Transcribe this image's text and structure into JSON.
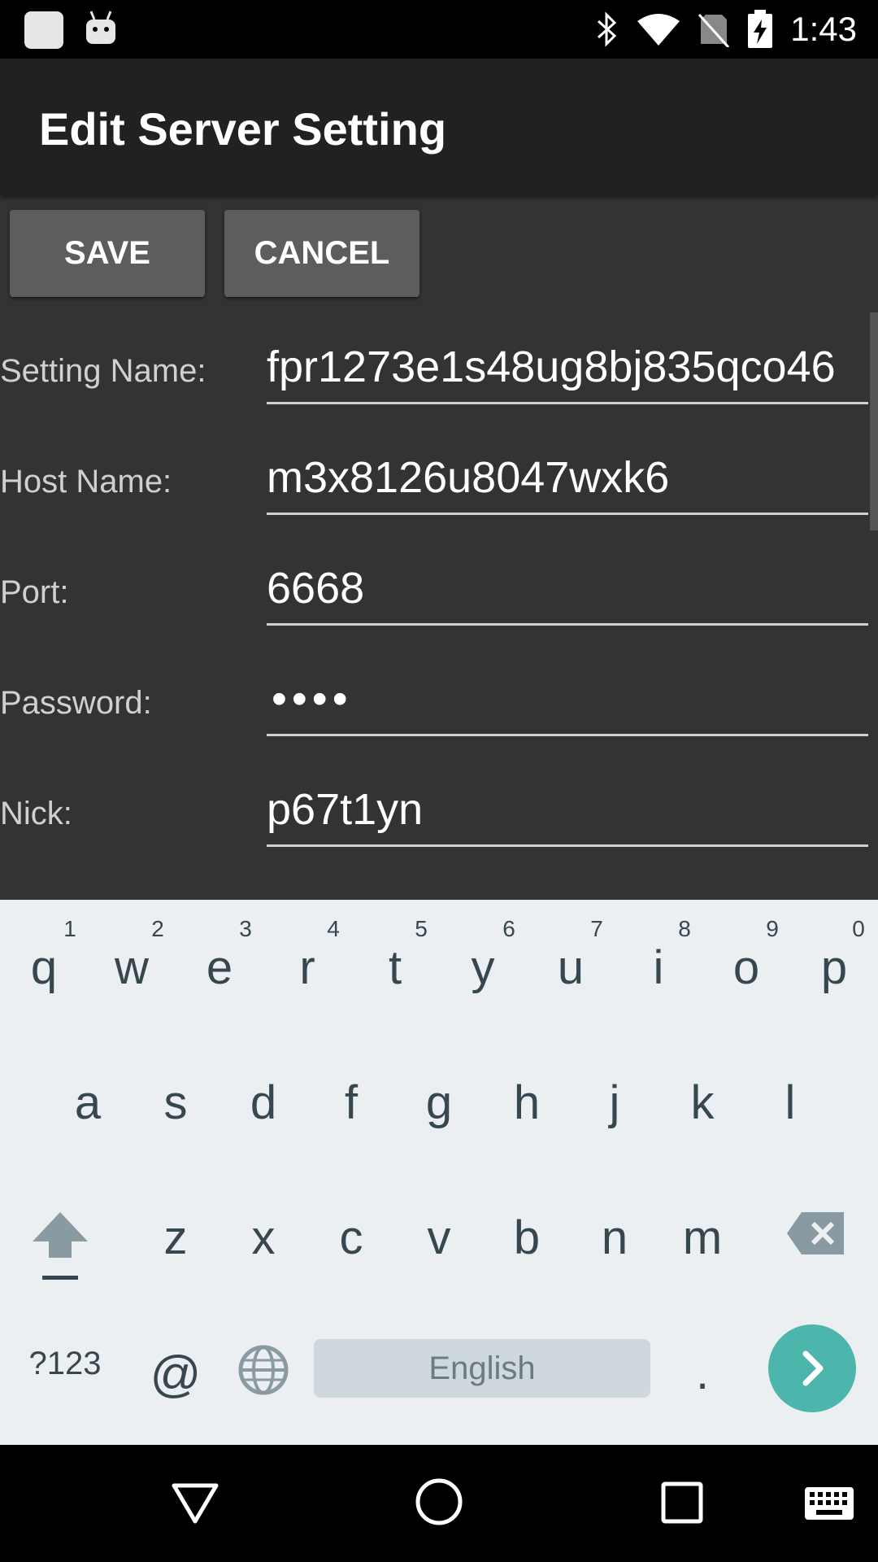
{
  "status_bar": {
    "time": "1:43",
    "icons": [
      "notification-square-icon",
      "android-icon",
      "bluetooth-icon",
      "wifi-icon",
      "no-sim-icon",
      "battery-charging-icon"
    ]
  },
  "app_bar": {
    "title": "Edit Server Setting"
  },
  "buttons": {
    "save": "SAVE",
    "cancel": "CANCEL"
  },
  "form": {
    "setting_name": {
      "label": "Setting Name:",
      "value": "fpr1273e1s48ug8bj835qco46"
    },
    "host_name": {
      "label": "Host Name:",
      "value": "m3x8126u8047wxk6"
    },
    "port": {
      "label": "Port:",
      "value": "6668"
    },
    "password": {
      "label": "Password:",
      "value": "••••"
    },
    "nick": {
      "label": "Nick:",
      "value": "p67t1yn"
    }
  },
  "keyboard": {
    "row1": [
      "q",
      "w",
      "e",
      "r",
      "t",
      "y",
      "u",
      "i",
      "o",
      "p"
    ],
    "row1_hints": [
      "1",
      "2",
      "3",
      "4",
      "5",
      "6",
      "7",
      "8",
      "9",
      "0"
    ],
    "row2": [
      "a",
      "s",
      "d",
      "f",
      "g",
      "h",
      "j",
      "k",
      "l"
    ],
    "row3": [
      "z",
      "x",
      "c",
      "v",
      "b",
      "n",
      "m"
    ],
    "symbols_key": "?123",
    "at_key": "@",
    "space_label": "English",
    "period_key": ".",
    "colors": {
      "background": "#eceff1",
      "go_key": "#4db6ac"
    }
  },
  "nav_bar": {
    "icons": [
      "back-icon",
      "home-icon",
      "recents-icon",
      "keyboard-switch-icon"
    ]
  }
}
